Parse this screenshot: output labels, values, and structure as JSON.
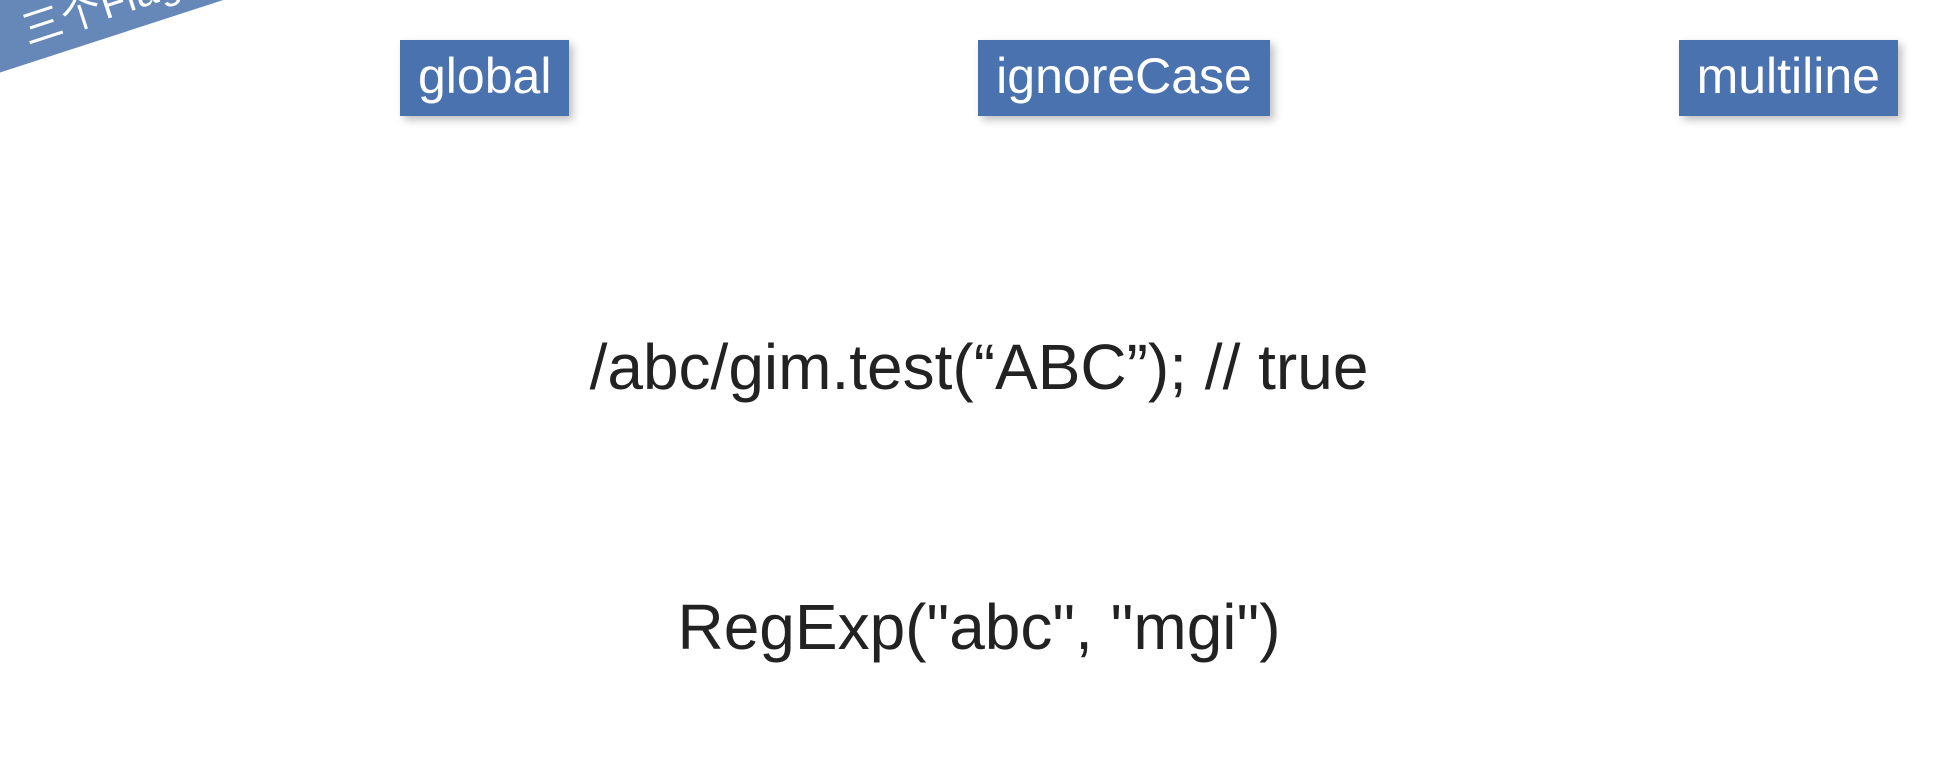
{
  "ribbon": {
    "label": "三个Flag"
  },
  "flags": {
    "global": "global",
    "ignoreCase": "ignoreCase",
    "multiline": "multiline"
  },
  "code": {
    "line1": "/abc/gim.test(“ABC”);  // true",
    "line2": "RegExp(\"abc\", \"mgi\")"
  }
}
